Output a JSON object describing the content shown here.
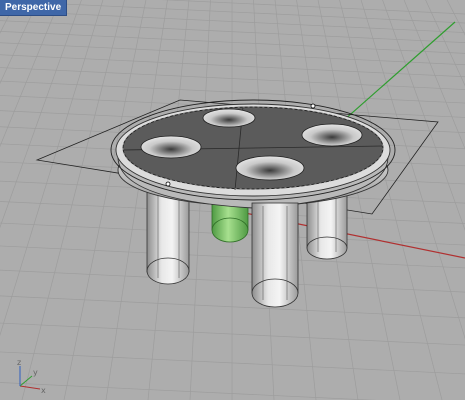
{
  "viewport": {
    "title": "Perspective"
  },
  "gizmo": {
    "x_label": "x",
    "y_label": "y",
    "z_label": "z"
  },
  "colors": {
    "background": "#adadad",
    "grid": "#9a9a9a",
    "x_axis": "#b03030",
    "y_axis": "#2f9e2f",
    "tab": "#3f67a8",
    "selected_leg": "#7fce6a"
  },
  "scene": {
    "object": "table-with-four-legs",
    "legs": 4,
    "sockets": 4,
    "selected_part": "back-left-leg"
  }
}
